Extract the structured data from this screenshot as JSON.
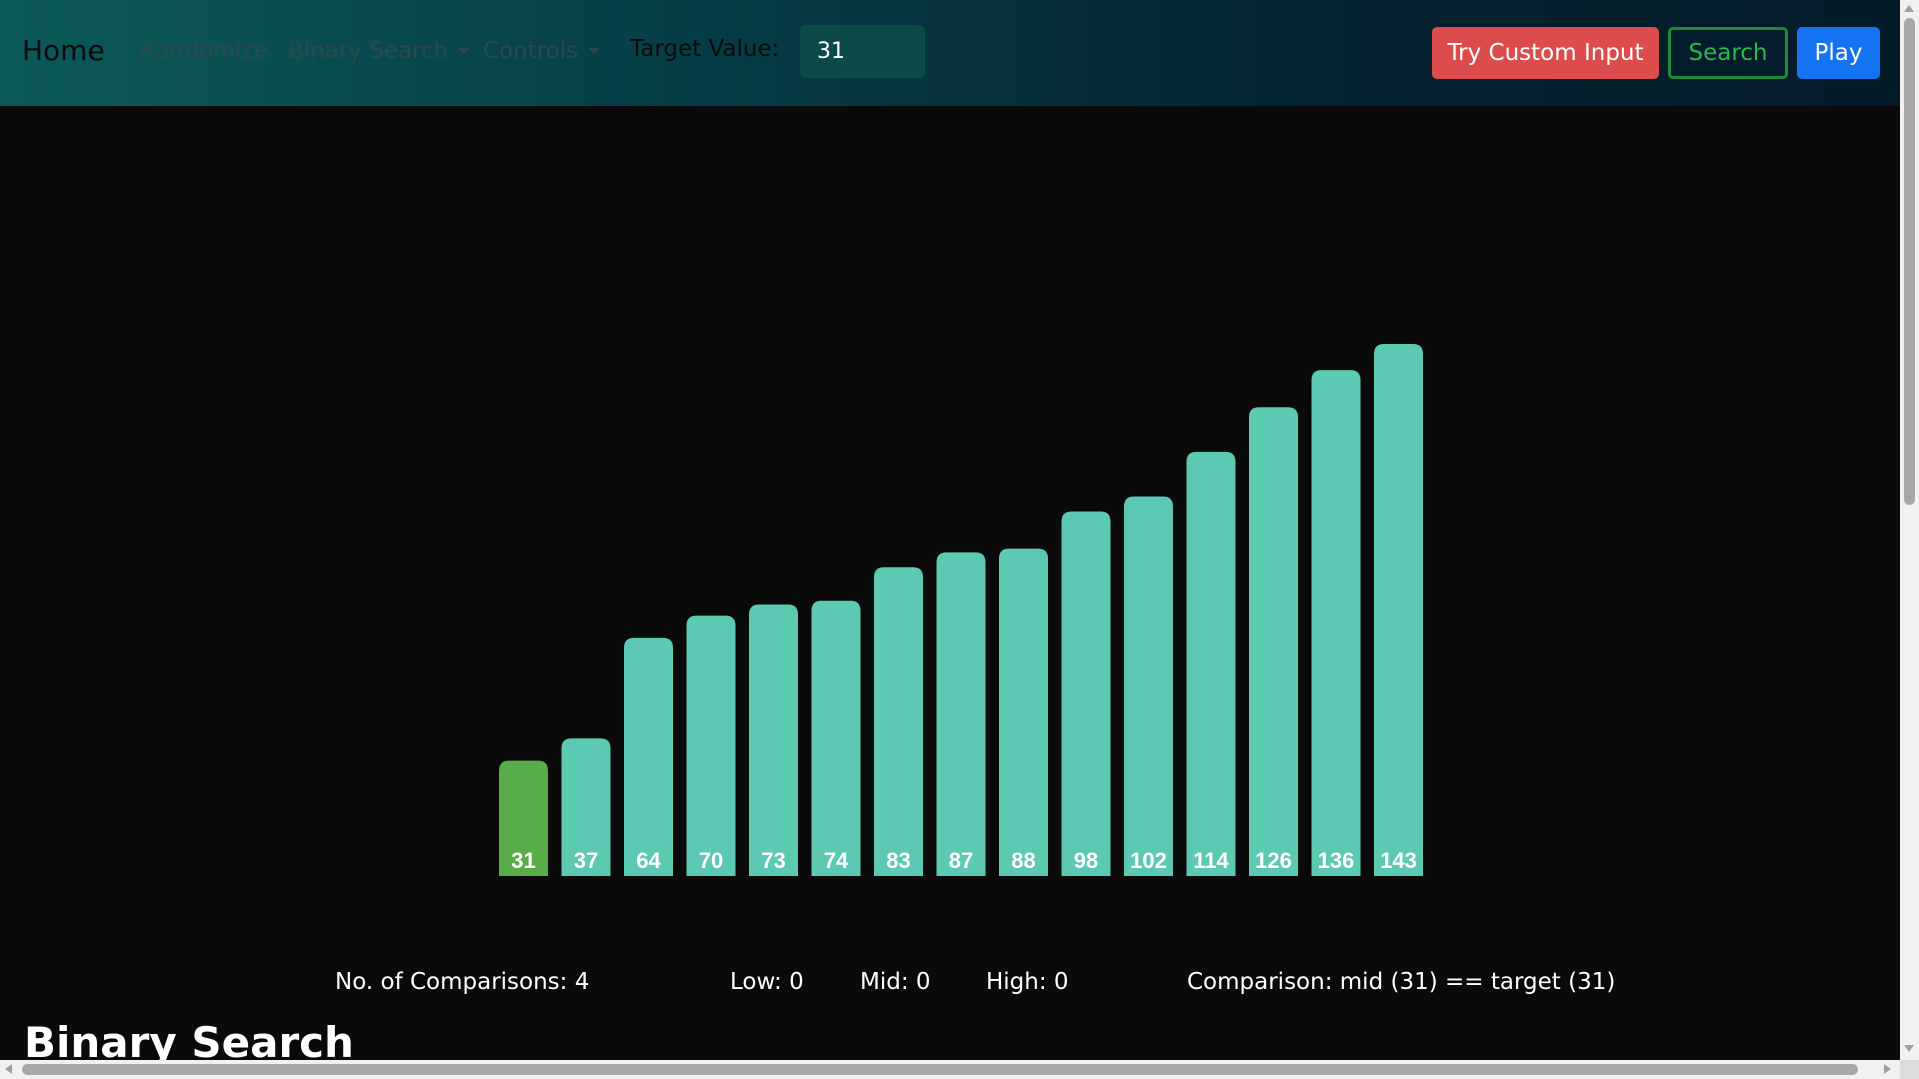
{
  "navbar": {
    "brand": "Home",
    "randomize_label": "Randomize",
    "algorithm_label": "Binary Search",
    "controls_label": "Controls",
    "target_label": "Target Value:",
    "target_value": "31",
    "custom_input_label": "Try Custom Input",
    "search_label": "Search",
    "play_label": "Play"
  },
  "chart_data": {
    "type": "bar",
    "categories": [
      "31",
      "37",
      "64",
      "70",
      "73",
      "74",
      "83",
      "87",
      "88",
      "98",
      "102",
      "114",
      "126",
      "136",
      "143"
    ],
    "values": [
      31,
      37,
      64,
      70,
      73,
      74,
      83,
      87,
      88,
      98,
      102,
      114,
      126,
      136,
      143
    ],
    "highlighted_index": 0,
    "colors": {
      "default": "#5ccab3",
      "found": "#58ad49"
    }
  },
  "stats": {
    "comparisons": "No. of Comparisons: 4",
    "low": "Low: 0",
    "mid": "Mid: 0",
    "high": "High: 0",
    "comparison": "Comparison: mid (31) == target (31)"
  },
  "page_title": "Binary Search"
}
